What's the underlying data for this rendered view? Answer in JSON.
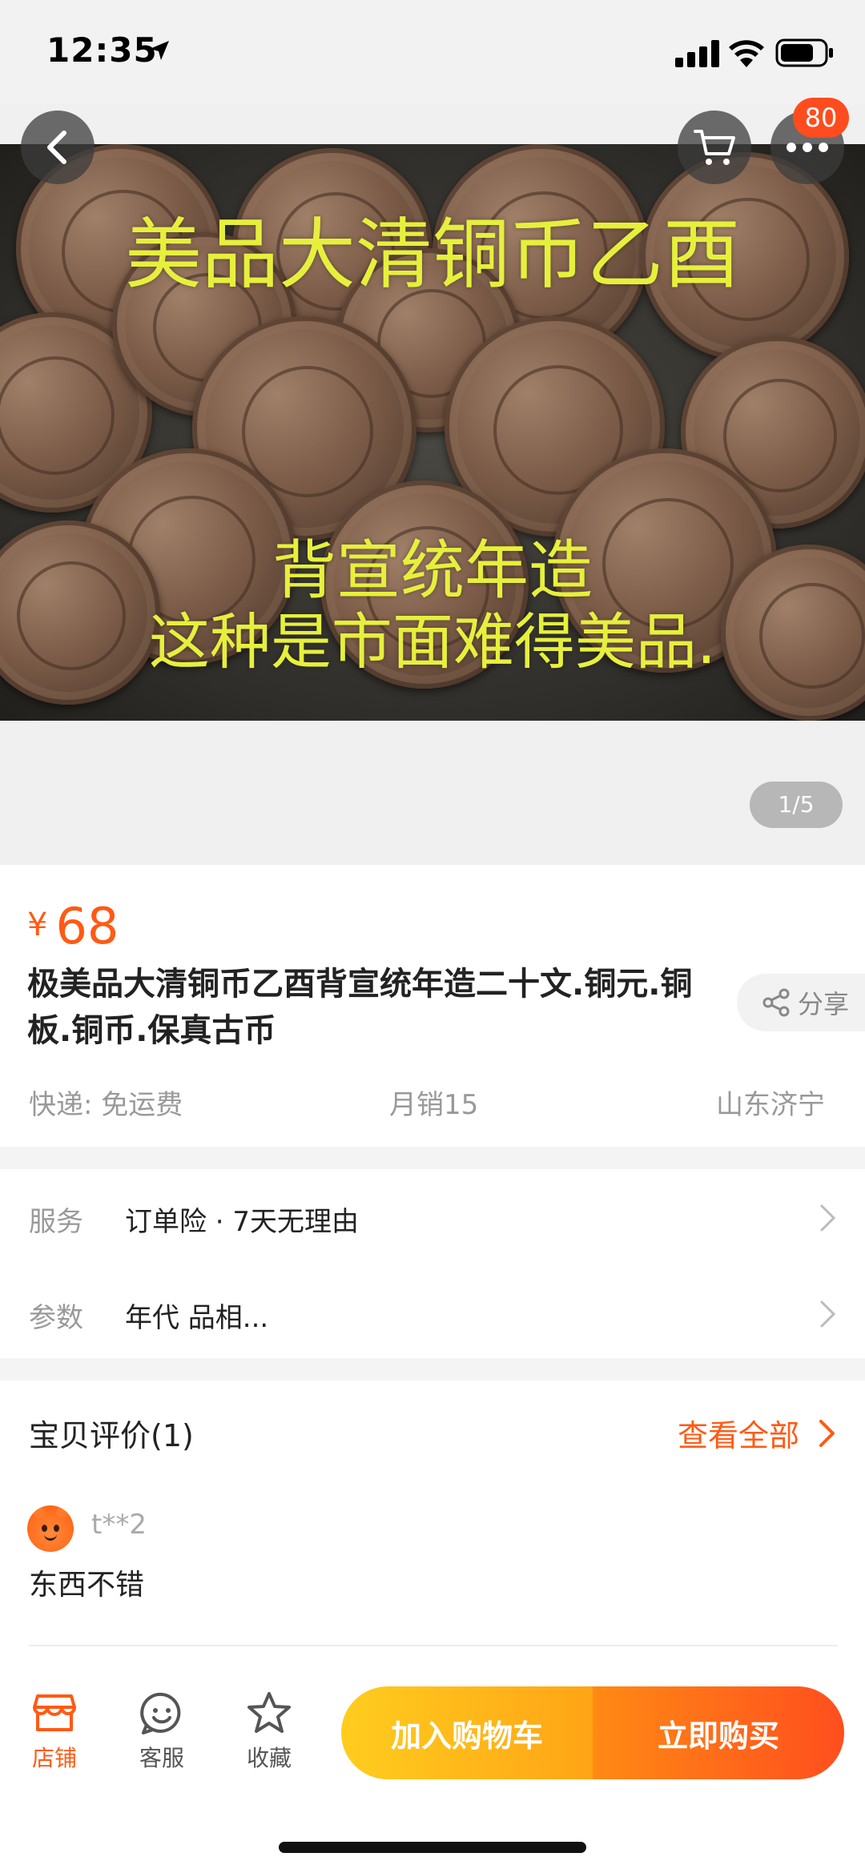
{
  "status_bar": {
    "time": "12:35"
  },
  "hero": {
    "overlay_line1": "美品大清铜币乙酉",
    "overlay_line2": "背宣统年造",
    "overlay_line3": "这种是市面难得美品.",
    "cart_badge": "80",
    "pager": "1/5"
  },
  "product": {
    "currency": "¥",
    "price": "68",
    "title": "极美品大清铜币乙酉背宣统年造二十文.铜元.铜板.铜币.保真古币",
    "share_label": "分享",
    "shipping": "快递: 免运费",
    "monthly_sales": "月销15",
    "location": "山东济宁"
  },
  "details": {
    "service_label": "服务",
    "service_value": "订单险 · 7天无理由",
    "params_label": "参数",
    "params_value": "年代 品相..."
  },
  "reviews": {
    "title": "宝贝评价(1)",
    "view_all": "查看全部",
    "items": [
      {
        "user": "t**2",
        "text": "东西不错"
      }
    ]
  },
  "bottom_bar": {
    "shop_label": "店铺",
    "service_label": "客服",
    "favorite_label": "收藏",
    "add_to_cart": "加入购物车",
    "buy_now": "立即购买"
  },
  "colors": {
    "accent": "#ff5a14",
    "overlay_text": "#e6f03c",
    "cart_button": "#ffb41a",
    "buy_button": "#ff5a1a"
  },
  "icons": [
    "location-arrow-icon",
    "signal-icon",
    "wifi-icon",
    "battery-icon",
    "back-icon",
    "cart-icon",
    "more-icon",
    "share-icon",
    "chevron-right-icon",
    "shop-icon",
    "customer-service-icon",
    "star-icon"
  ]
}
